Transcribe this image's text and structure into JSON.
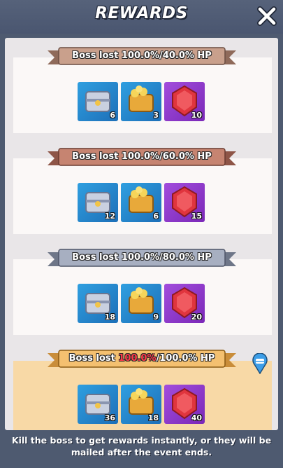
{
  "header": {
    "title": "REWARDS"
  },
  "tiers": [
    {
      "label_prefix": "Boss lost ",
      "label_highlight": "",
      "label_suffix": "100.0%/40.0% HP",
      "items": [
        {
          "icon": "silver-chest-icon",
          "count": "6"
        },
        {
          "icon": "gold-chest-icon",
          "count": "3"
        },
        {
          "icon": "ruby-gem-icon",
          "count": "10"
        }
      ]
    },
    {
      "label_prefix": "Boss lost ",
      "label_highlight": "",
      "label_suffix": "100.0%/60.0% HP",
      "items": [
        {
          "icon": "silver-chest-icon",
          "count": "12"
        },
        {
          "icon": "gold-chest-icon",
          "count": "6"
        },
        {
          "icon": "ruby-gem-icon",
          "count": "15"
        }
      ]
    },
    {
      "label_prefix": "Boss lost ",
      "label_highlight": "",
      "label_suffix": "100.0%/80.0% HP",
      "items": [
        {
          "icon": "silver-chest-icon",
          "count": "18"
        },
        {
          "icon": "gold-chest-icon",
          "count": "9"
        },
        {
          "icon": "ruby-gem-icon",
          "count": "20"
        }
      ]
    },
    {
      "label_prefix": "Boss lost ",
      "label_highlight": "100.0%",
      "label_suffix": "/100.0% HP",
      "items": [
        {
          "icon": "silver-chest-icon",
          "count": "36"
        },
        {
          "icon": "gold-chest-icon",
          "count": "18"
        },
        {
          "icon": "ruby-gem-icon",
          "count": "40"
        }
      ]
    }
  ],
  "footer": {
    "line1": "Kill the boss to get rewards instantly, or they will be",
    "line2": "mailed after the event ends."
  },
  "colors": {
    "background": "#4e5a70",
    "ribbon_bronze": "#c9a08c",
    "ribbon_copper": "#c68471",
    "ribbon_silver": "#a7afc1",
    "ribbon_gold": "#f4c070",
    "highlight_red": "#ff3a4a",
    "item_blue": "#2f9fe0",
    "item_purple": "#a24ddc"
  }
}
